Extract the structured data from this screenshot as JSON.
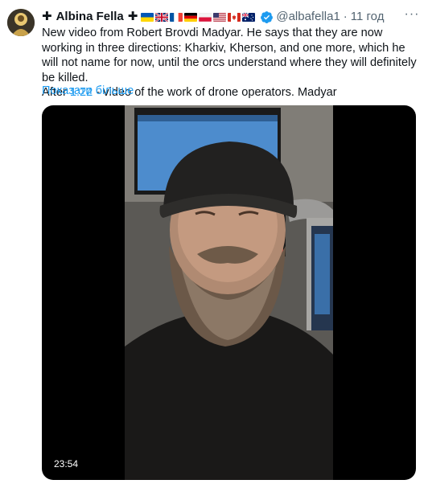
{
  "author": {
    "cross_prefix": "✚",
    "name": "Albina Fella",
    "cross_suffix": "✚",
    "flags": [
      "ukraine-flag",
      "uk-flag",
      "france-flag",
      "germany-flag",
      "poland-flag",
      "usa-flag",
      "canada-flag",
      "australia-flag"
    ],
    "handle": "@albafella1",
    "separator": "·",
    "time": "11 год"
  },
  "tweet": {
    "text_part1": "New video from Robert Brovdi Madyar. He says that they are now working in three directions: Kharkiv, Kherson, and one more, which he will not name for now, until the orcs understand where they will definitely be killed.",
    "text_part2_before": "After ",
    "text_link": "1:22",
    "text_part2_after": " - video of the work of drone operators. Madyar",
    "show_more": "Показати більше"
  },
  "media": {
    "duration": "23:54"
  },
  "colors": {
    "accent": "#1d9bf0",
    "text": "#0f1419",
    "secondary": "#536471"
  }
}
